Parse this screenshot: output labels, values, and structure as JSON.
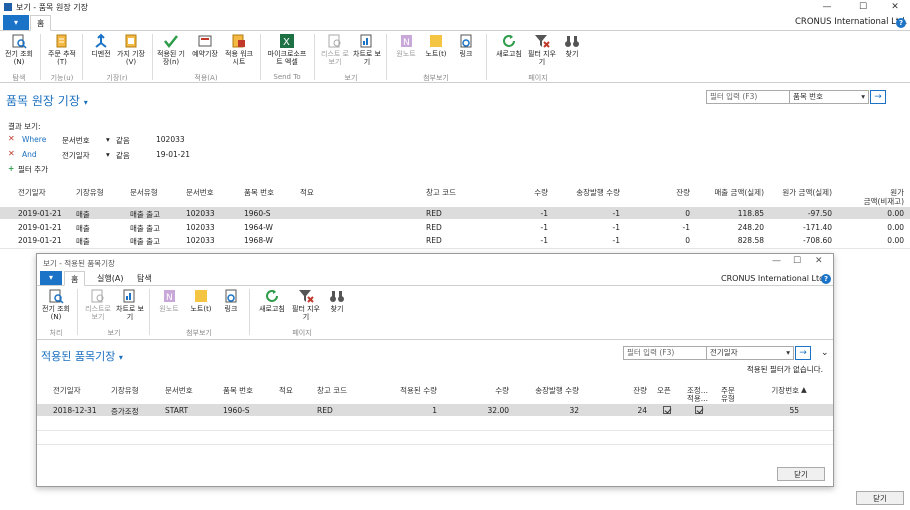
{
  "window": {
    "title": "보기 - 품목 원장 기장",
    "company": "CRONUS International Ltd.",
    "minimize": "—",
    "maximize": "☐",
    "close": "✕"
  },
  "tabs": {
    "drop": "▾",
    "home": "홈"
  },
  "ribbon": {
    "groups": [
      "탐색",
      "기능(u)",
      "기장(r)",
      "적용(A)",
      "Send To",
      "보기",
      "첨부보기",
      "페이지"
    ],
    "buttons": [
      "전기 조회(N)",
      "주문 추적(T)",
      "디멘전",
      "가지 기장(V)",
      "적용된 기장(n)",
      "예약기장",
      "적용 워크시트",
      "마이크로소프트 엑셀",
      "리스트 로 보기",
      "차트로 보기",
      "원노트",
      "노트(t)",
      "링크",
      "새로고침",
      "필터 지우기",
      "찾기"
    ]
  },
  "page": {
    "title": "품목 원장 기장",
    "title_arrow": "▾",
    "filter_placeholder": "필터 입력 (F3)",
    "filter_field": "품목 번호",
    "go": "→"
  },
  "filters": {
    "heading": "결과 보기:",
    "rows": [
      {
        "op": "Where",
        "field": "문서번호",
        "cmp": "같음",
        "value": "102033"
      },
      {
        "op": "And",
        "field": "전기일자",
        "cmp": "같음",
        "value": "19-01-21"
      }
    ],
    "add": "필터 추가"
  },
  "table": {
    "headers": [
      "전기일자",
      "기장유형",
      "문서유형",
      "문서번호",
      "품목 번호",
      "적요",
      "창고 코드",
      "수량",
      "송장발행 수량",
      "잔량",
      "매출 금액(실제)",
      "원가 금액(실제)",
      "원가",
      "금액(비재고)"
    ],
    "rows": [
      [
        "2019-01-21",
        "매출",
        "매출 출고",
        "102033",
        "1960-S",
        "",
        "RED",
        "-1",
        "-1",
        "0",
        "118.85",
        "-97.50",
        "0.00"
      ],
      [
        "2019-01-21",
        "매출",
        "매출 출고",
        "102033",
        "1964-W",
        "",
        "RED",
        "-1",
        "-1",
        "-1",
        "248.20",
        "-171.40",
        "0.00"
      ],
      [
        "2019-01-21",
        "매출",
        "매출 출고",
        "102033",
        "1968-W",
        "",
        "RED",
        "-1",
        "-1",
        "0",
        "828.58",
        "-708.60",
        "0.00"
      ]
    ]
  },
  "close_button": "닫기",
  "dialog": {
    "title": "보기 - 적용된 품목기장",
    "company": "CRONUS International Ltd.",
    "tabs": [
      "홈",
      "실행(A)",
      "탐색"
    ],
    "buttons": [
      "전기 조회(N)",
      "리스트로 보기",
      "차트로 보기",
      "원노트",
      "노트(t)",
      "링크",
      "새로고침",
      "필터 지우기",
      "찾기"
    ],
    "groups": [
      "처리",
      "보기",
      "첨부보기",
      "페이지"
    ],
    "page_title": "적용된 품목기장",
    "filter_placeholder": "필터 입력 (F3)",
    "filter_field": "전기일자",
    "no_filter": "적용된 필터가 없습니다.",
    "headers": [
      "전기일자",
      "기장유형",
      "문서번호",
      "품목 번호",
      "적요",
      "창고 코드",
      "적용된 수량",
      "수량",
      "송장발행 수량",
      "잔량",
      "오픈",
      "조정...",
      "주문",
      "기장번호"
    ],
    "headers_sub": {
      "adj": "적용...",
      "order": "유형"
    },
    "row": {
      "date": "2018-12-31",
      "type": "증가조정",
      "doc": "START",
      "item": "1960-S",
      "desc": "",
      "loc": "RED",
      "applied": "1",
      "qty": "32.00",
      "inv": "32",
      "rem": "24",
      "entry": "55"
    },
    "close": "닫기"
  }
}
